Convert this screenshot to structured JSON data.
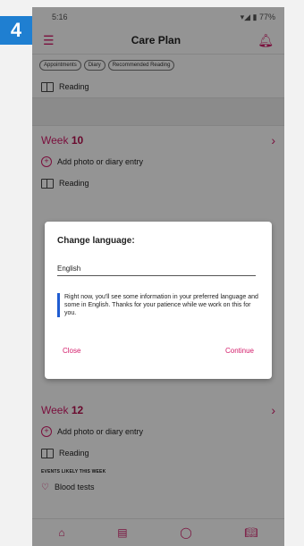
{
  "badge": "4",
  "status": {
    "time": "5:16",
    "battery": "77%"
  },
  "header": {
    "title": "Care Plan"
  },
  "chips": [
    "Appointments",
    "Diary",
    "Recommended Reading"
  ],
  "top_reading": "Reading",
  "week10": {
    "label": "Week",
    "number": "10",
    "add": "Add photo or diary entry",
    "reading": "Reading"
  },
  "week12": {
    "label": "Week",
    "number": "12",
    "add": "Add photo or diary entry",
    "reading": "Reading",
    "events_head": "EVENTS LIKELY THIS WEEK",
    "event": "Blood tests"
  },
  "dialog": {
    "title": "Change language:",
    "value": "English",
    "note": "Right now, you'll see some information in your preferred language and some in English. Thanks for your patience while we work on this for you.",
    "close": "Close",
    "continue": "Continue"
  },
  "icons": {
    "menu": "menu-icon",
    "bell": "bell-icon",
    "home": "home-icon",
    "document": "document-icon",
    "chat": "chat-icon",
    "book": "book-icon"
  },
  "colors": {
    "accent": "#d31c6a",
    "badge": "#1f7fd1",
    "note_bar": "#1f5cd1"
  }
}
